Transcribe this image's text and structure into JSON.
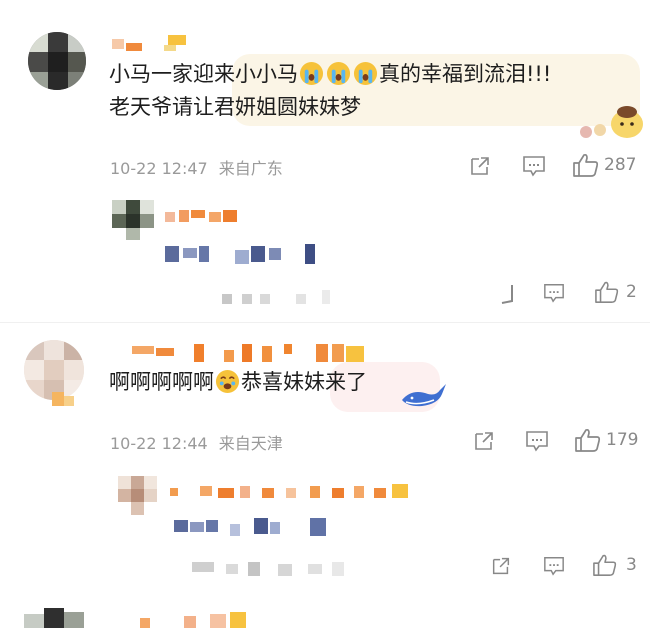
{
  "comments": [
    {
      "line1_a": "小马一家迎来小小马",
      "line1_b": "真的幸福到流泪!!!",
      "line2": "老天爷请让君妍姐圆妹妹梦",
      "time": "10-22 12:47",
      "location": "来自广东",
      "likes": "287",
      "reply": {
        "likes": "2"
      }
    },
    {
      "text_a": "啊啊啊啊啊",
      "text_b": "恭喜妹妹来了",
      "time": "10-22 12:44",
      "location": "来自天津",
      "likes": "179",
      "reply": {
        "likes": "3"
      }
    }
  ],
  "icons": {
    "share": "share-icon",
    "comment": "comment-icon",
    "like": "thumbs-up-icon",
    "emoji_cry": "crying-emoji-icon",
    "emoji_touched": "touched-emoji-icon"
  },
  "colors": {
    "meta": "#9a9a9a",
    "count": "#888888",
    "bubble1": "#fbf5e6",
    "bubble2": "#fdf0f0"
  }
}
